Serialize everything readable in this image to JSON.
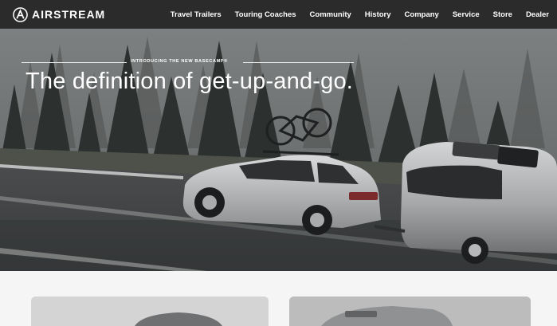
{
  "brand": {
    "name": "AIRSTREAM",
    "logo_icon": "airstream-logo-icon"
  },
  "nav": {
    "items": [
      {
        "label": "Travel Trailers"
      },
      {
        "label": "Touring Coaches"
      },
      {
        "label": "Community"
      },
      {
        "label": "History"
      },
      {
        "label": "Company"
      },
      {
        "label": "Service"
      },
      {
        "label": "Store"
      },
      {
        "label": "Dealer"
      }
    ]
  },
  "hero": {
    "eyebrow": "INTRODUCING THE NEW BASECAMP®",
    "headline": "The definition of get-up-and-go."
  },
  "colors": {
    "nav_background": "#2b2b2b",
    "nav_text": "#ffffff",
    "page_background": "#f5f5f5"
  }
}
